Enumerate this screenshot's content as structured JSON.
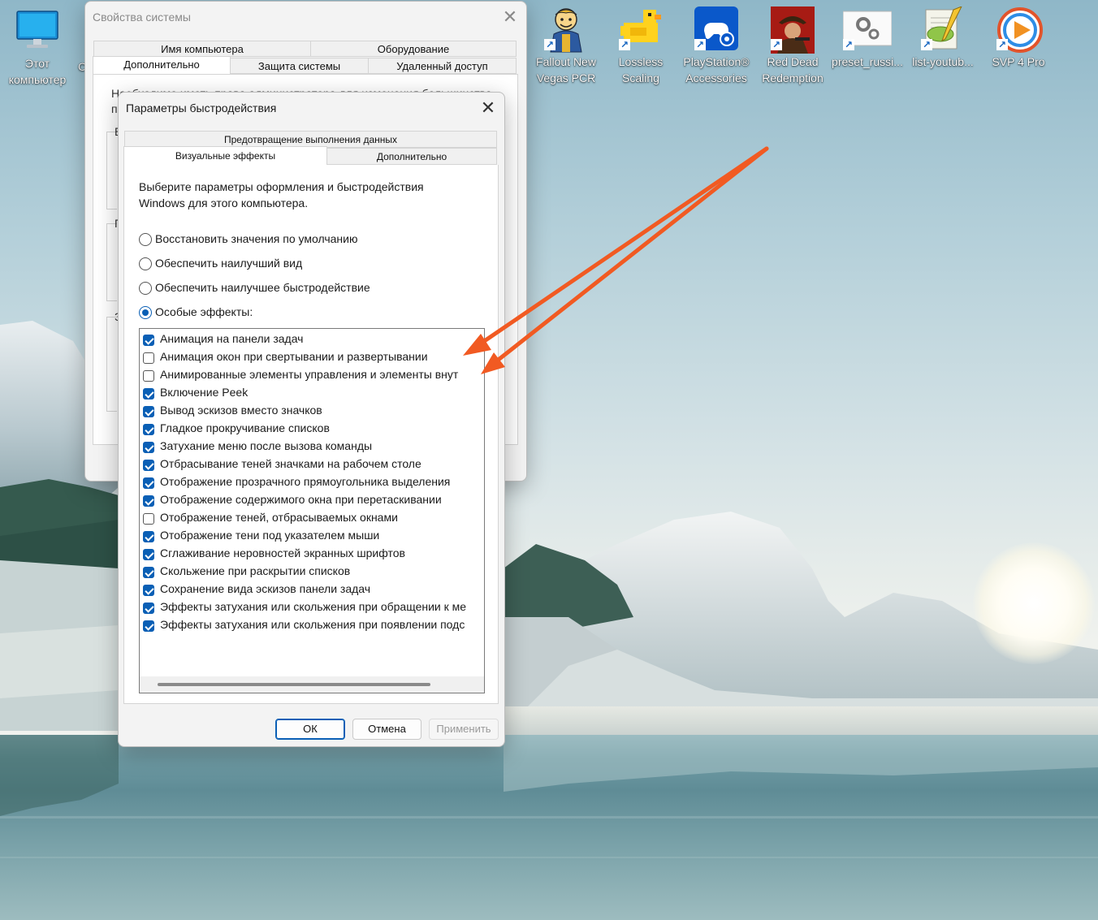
{
  "desktop": {
    "icons": [
      {
        "label": "Этот компьютер"
      },
      {
        "label": "С"
      },
      {
        "label": "Fallout New Vegas PCR"
      },
      {
        "label": "Lossless Scaling"
      },
      {
        "label": "PlayStation® Accessories"
      },
      {
        "label": "Red Dead Redemption"
      },
      {
        "label": "preset_russi..."
      },
      {
        "label": "list-youtub..."
      },
      {
        "label": "SVP 4 Pro"
      }
    ]
  },
  "system_properties": {
    "title": "Свойства системы",
    "tabs_row1": [
      "Имя компьютера",
      "Оборудование"
    ],
    "tabs_row2": [
      "Дополнительно",
      "Защита системы",
      "Удаленный доступ"
    ],
    "intro_fragment": "Необходимо иметь права администратора для изменения большинства",
    "fragment_p": "п",
    "fragment_b": "Б",
    "fragment_p2": "П",
    "fragment_z": "З"
  },
  "performance": {
    "title": "Параметры быстродействия",
    "tab_top": "Предотвращение выполнения данных",
    "tab_visual": "Визуальные эффекты",
    "tab_advanced": "Дополнительно",
    "description": "Выберите параметры оформления и быстродействия Windows для этого компьютера.",
    "options": [
      {
        "label": "Восстановить значения по умолчанию",
        "selected": false
      },
      {
        "label": "Обеспечить наилучший вид",
        "selected": false
      },
      {
        "label": "Обеспечить наилучшее быстродействие",
        "selected": false
      },
      {
        "label": "Особые эффекты:",
        "selected": true
      }
    ],
    "effects": [
      {
        "label": "Анимация на панели задач",
        "checked": true
      },
      {
        "label": "Анимация окон при свертывании и развертывании",
        "checked": false
      },
      {
        "label": "Анимированные элементы управления и элементы внут",
        "checked": false
      },
      {
        "label": "Включение Peek",
        "checked": true
      },
      {
        "label": "Вывод эскизов вместо значков",
        "checked": true
      },
      {
        "label": "Гладкое прокручивание списков",
        "checked": true
      },
      {
        "label": "Затухание меню после вызова команды",
        "checked": true
      },
      {
        "label": "Отбрасывание теней значками на рабочем столе",
        "checked": true
      },
      {
        "label": "Отображение прозрачного прямоугольника выделения",
        "checked": true
      },
      {
        "label": "Отображение содержимого окна при перетаскивании",
        "checked": true
      },
      {
        "label": "Отображение теней, отбрасываемых окнами",
        "checked": false
      },
      {
        "label": "Отображение тени под указателем мыши",
        "checked": true
      },
      {
        "label": "Сглаживание неровностей экранных шрифтов",
        "checked": true
      },
      {
        "label": "Скольжение при раскрытии списков",
        "checked": true
      },
      {
        "label": "Сохранение вида эскизов панели задач",
        "checked": true
      },
      {
        "label": "Эффекты затухания или скольжения при обращении к ме",
        "checked": true
      },
      {
        "label": "Эффекты затухания или скольжения при появлении подс",
        "checked": true
      }
    ],
    "buttons": {
      "ok": "ОК",
      "cancel": "Отмена",
      "apply": "Применить"
    }
  },
  "annotation": {
    "arrow_color": "#f15a22"
  }
}
